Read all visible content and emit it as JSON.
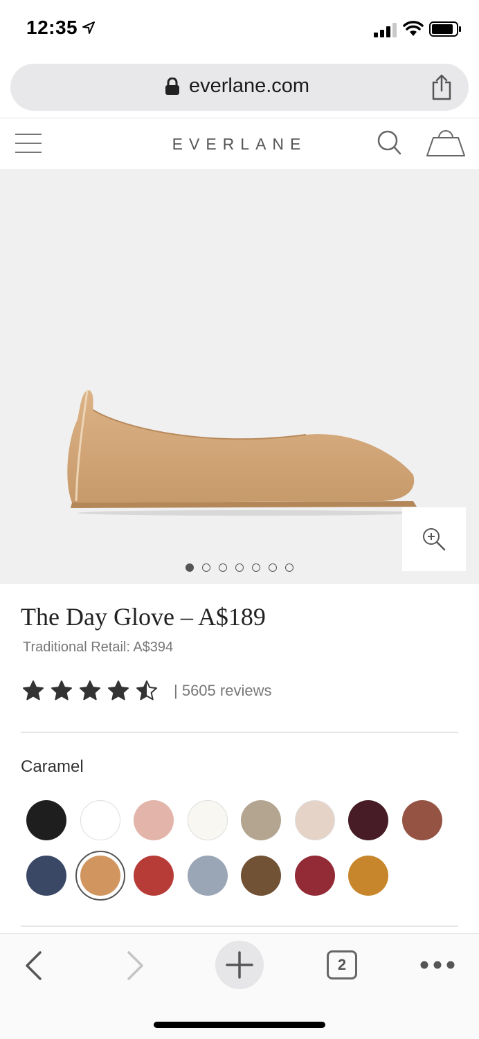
{
  "status_bar": {
    "time": "12:35"
  },
  "browser": {
    "url": "everlane.com",
    "tab_count": "2"
  },
  "header": {
    "logo": "EVERLANE"
  },
  "gallery": {
    "image_count": 7,
    "active_index": 0
  },
  "product": {
    "title": "The Day Glove – A$189",
    "retail": "Traditional Retail: A$394",
    "rating": 4.5,
    "reviews": "| 5605 reviews",
    "selected_color": "Caramel"
  },
  "colors": {
    "row1": [
      "#1e1e1e",
      "#ffffff",
      "#e2b4aa",
      "#f9f7f2",
      "#b3a58f",
      "#e6d3c8",
      "#471c26",
      "#955344"
    ],
    "row2": [
      "#3a4765",
      "#d19660",
      "#b73c38",
      "#9aa5b5",
      "#715235",
      "#932b37",
      "#c7862b"
    ],
    "selected_row": 2,
    "selected_index": 1
  }
}
